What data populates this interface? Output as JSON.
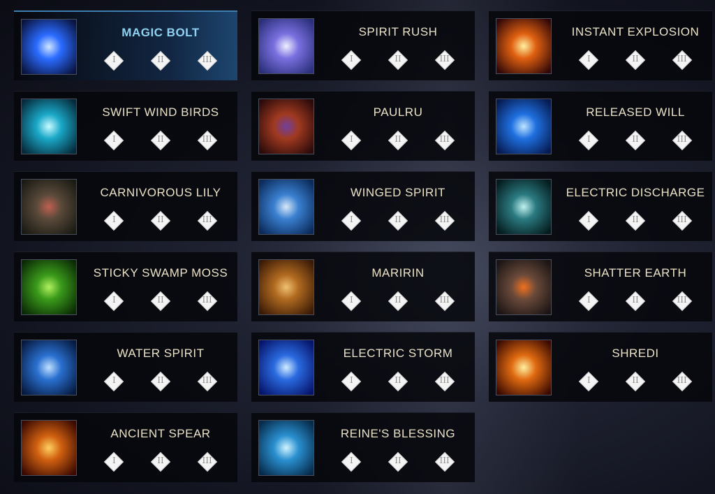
{
  "skills": [
    {
      "name": "MAGIC BOLT",
      "icon": "magic-bolt-icon",
      "colors": [
        "#0a1440",
        "#2a6bff",
        "#cfe6ff"
      ],
      "selected": true
    },
    {
      "name": "SPIRIT RUSH",
      "icon": "spirit-rush-icon",
      "colors": [
        "#2a2f7a",
        "#7a70e0",
        "#f0f0ff"
      ],
      "selected": false
    },
    {
      "name": "INSTANT EXPLOSION",
      "icon": "instant-explosion-icon",
      "colors": [
        "#300808",
        "#e06010",
        "#fff0a0"
      ],
      "selected": false
    },
    {
      "name": "SWIFT WIND BIRDS",
      "icon": "swift-wind-birds-icon",
      "colors": [
        "#062a3a",
        "#1aa8c8",
        "#c8fbff"
      ],
      "selected": false
    },
    {
      "name": "PAULRU",
      "icon": "paulru-icon",
      "colors": [
        "#2a0a0a",
        "#a03a20",
        "#7040a0"
      ],
      "selected": false
    },
    {
      "name": "RELEASED WILL",
      "icon": "released-will-icon",
      "colors": [
        "#061a50",
        "#1f70e0",
        "#bfe4ff"
      ],
      "selected": false
    },
    {
      "name": "CARNIVOROUS LILY",
      "icon": "carnivorous-lily-icon",
      "colors": [
        "#1a1a14",
        "#5a4a3a",
        "#c06050"
      ],
      "selected": false
    },
    {
      "name": "WINGED SPIRIT",
      "icon": "winged-spirit-icon",
      "colors": [
        "#0a2a5a",
        "#3a80d0",
        "#d8e8f8"
      ],
      "selected": false
    },
    {
      "name": "ELECTRIC DISCHARGE",
      "icon": "electric-discharge-icon",
      "colors": [
        "#041a1c",
        "#2a7a80",
        "#c0f0f0"
      ],
      "selected": false
    },
    {
      "name": "STICKY SWAMP MOSS",
      "icon": "sticky-swamp-moss-icon",
      "colors": [
        "#0a2a06",
        "#3a9a1a",
        "#b0f060"
      ],
      "selected": false
    },
    {
      "name": "MARIRIN",
      "icon": "maririn-icon",
      "colors": [
        "#3a1a06",
        "#b06a20",
        "#f0c070"
      ],
      "selected": false
    },
    {
      "name": "SHATTER EARTH",
      "icon": "shatter-earth-icon",
      "colors": [
        "#1a1414",
        "#6a4a3a",
        "#f07020"
      ],
      "selected": false
    },
    {
      "name": "WATER SPIRIT",
      "icon": "water-spirit-icon",
      "colors": [
        "#061a40",
        "#2a70d0",
        "#c0e0ff"
      ],
      "selected": false
    },
    {
      "name": "ELECTRIC STORM",
      "icon": "electric-storm-icon",
      "colors": [
        "#06146a",
        "#2a6ae0",
        "#d0ecff"
      ],
      "selected": false
    },
    {
      "name": "SHREDI",
      "icon": "shredi-icon",
      "colors": [
        "#3a0a02",
        "#e06a10",
        "#fff0a0"
      ],
      "selected": false
    },
    {
      "name": "ANCIENT SPEAR",
      "icon": "ancient-spear-icon",
      "colors": [
        "#3a0a02",
        "#d06010",
        "#ffd060"
      ],
      "selected": false
    },
    {
      "name": "REINE'S BLESSING",
      "icon": "reines-blessing-icon",
      "colors": [
        "#062a4a",
        "#2a90d0",
        "#d0f4ff"
      ],
      "selected": false
    }
  ],
  "levels": [
    "I",
    "II",
    "III"
  ]
}
